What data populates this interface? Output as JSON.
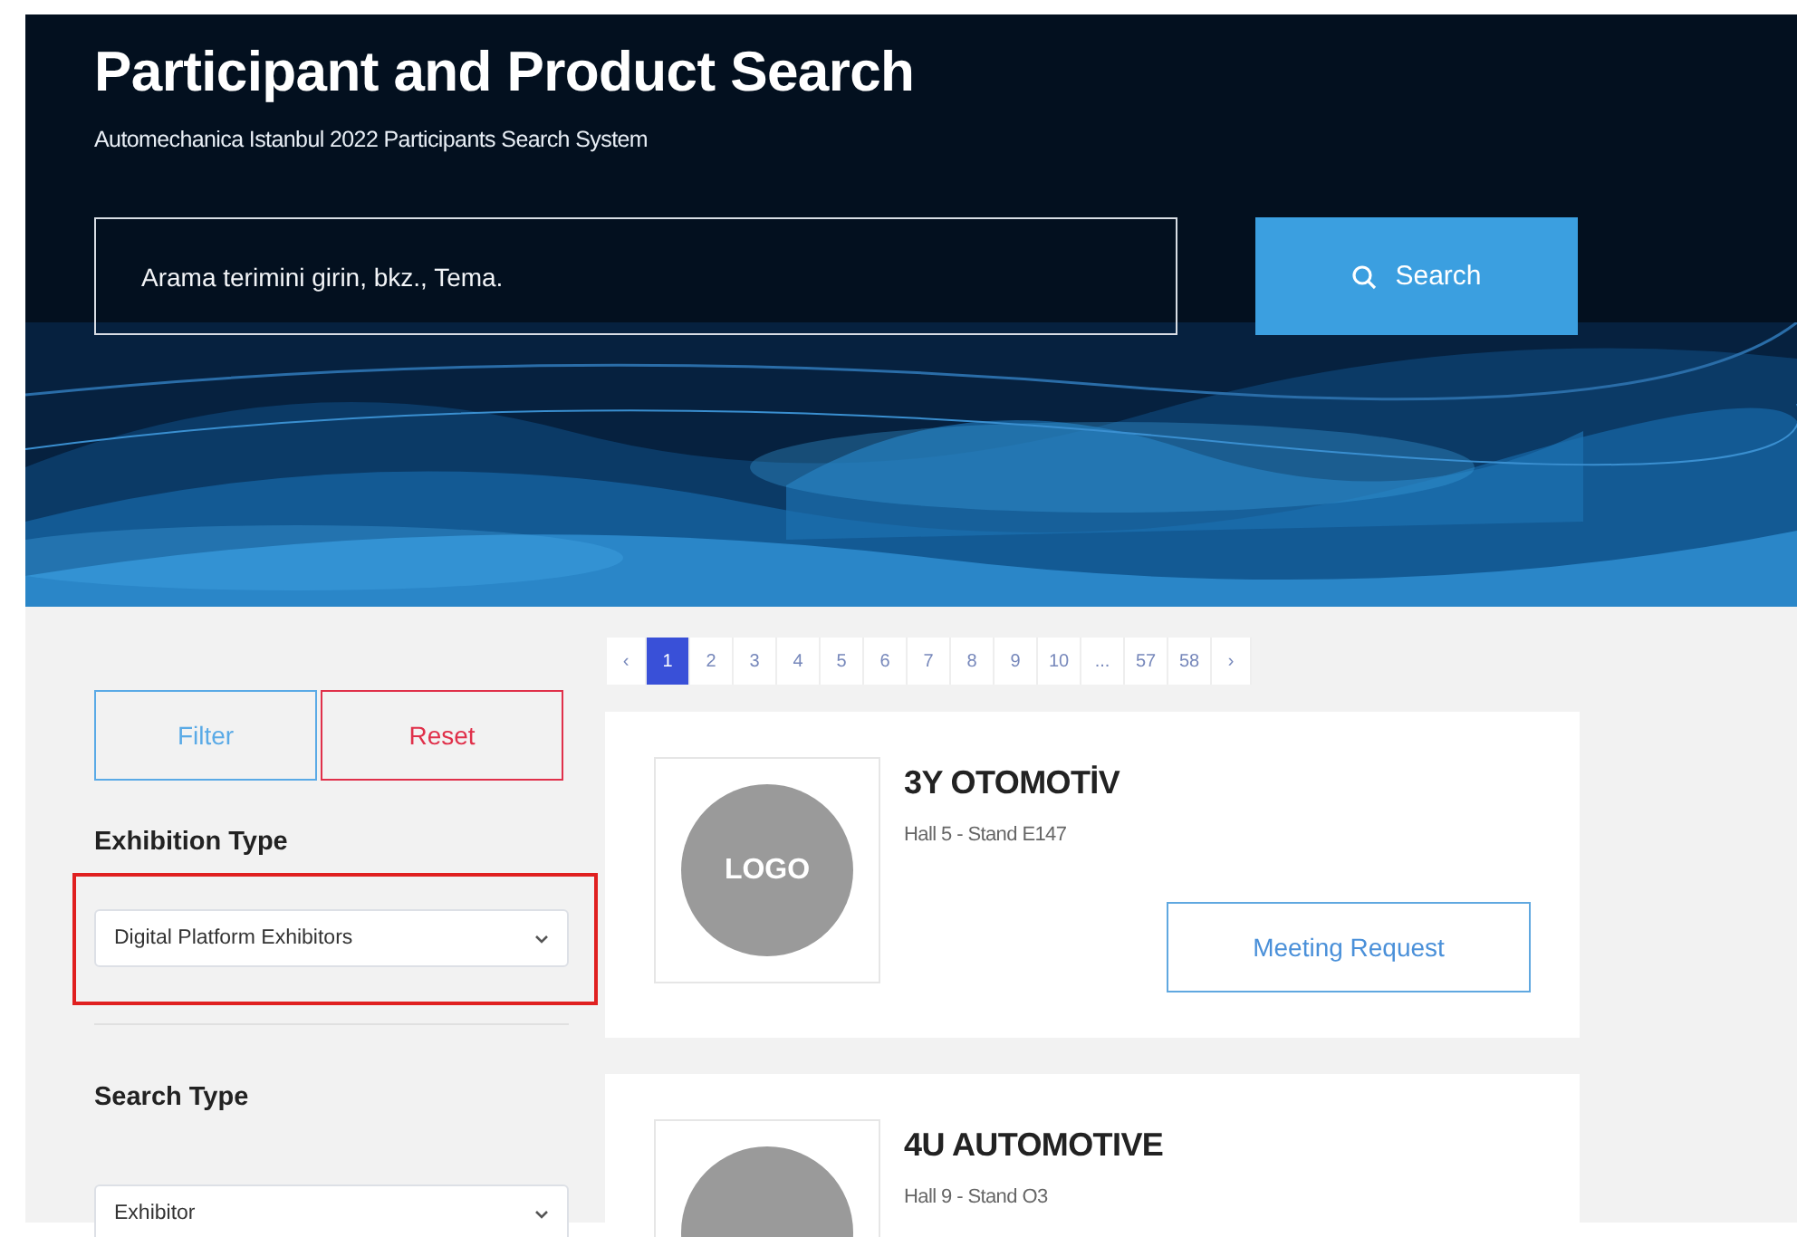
{
  "header": {
    "title": "Participant and Product Search",
    "subtitle": "Automechanica Istanbul 2022 Participants Search System",
    "search": {
      "placeholder": "Arama terimini girin, bkz., Tema.",
      "button": "Search"
    }
  },
  "sidebar": {
    "filter_button": "Filter",
    "reset_button": "Reset",
    "sections": [
      {
        "heading": "Exhibition Type",
        "value": "Digital Platform Exhibitors",
        "highlighted": true
      },
      {
        "heading": "Search Type",
        "value": "Exhibitor",
        "highlighted": false
      }
    ]
  },
  "pagination": {
    "prev": "‹",
    "next": "›",
    "pages": [
      {
        "label": "1",
        "selected": true
      },
      {
        "label": "2",
        "selected": false
      },
      {
        "label": "3",
        "selected": false
      },
      {
        "label": "4",
        "selected": false
      },
      {
        "label": "5",
        "selected": false
      },
      {
        "label": "6",
        "selected": false
      },
      {
        "label": "7",
        "selected": false
      },
      {
        "label": "8",
        "selected": false
      },
      {
        "label": "9",
        "selected": false
      },
      {
        "label": "10",
        "selected": false
      },
      {
        "label": "...",
        "selected": false
      },
      {
        "label": "57",
        "selected": false
      },
      {
        "label": "58",
        "selected": false
      }
    ]
  },
  "results": [
    {
      "name": "3Y OTOMOTİV",
      "location": "Hall 5 - Stand E147",
      "logo": "LOGO",
      "button": "Meeting Request"
    },
    {
      "name": "4U AUTOMOTIVE",
      "location": "Hall 9 - Stand O3"
    }
  ]
}
